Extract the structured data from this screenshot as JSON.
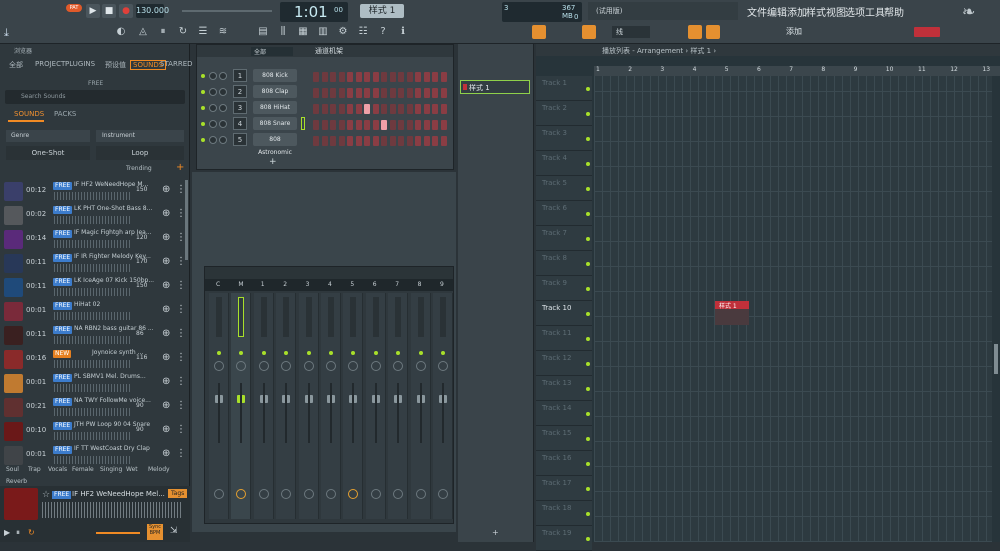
{
  "toolbar": {
    "mode": "PAT",
    "tempo": "130.000",
    "time": "1:01",
    "time_sub": "00",
    "pattern": "样式 1",
    "cpu": "3",
    "mem": "367 MB",
    "mem2": "0",
    "hint": "(试用版)",
    "snap": "线",
    "add_label": "添加"
  },
  "menu": [
    "文件",
    "编辑",
    "添加",
    "样式",
    "视图",
    "选项",
    "工具",
    "帮助"
  ],
  "browser": {
    "title": "浏览器",
    "tabs": [
      "全部",
      "PROJECT",
      "PLUGINS",
      "预设值",
      "SOUNDS",
      "STARRED"
    ],
    "free_toggle": "FREE",
    "search": "Search Sounds",
    "sub_tabs": [
      "SOUNDS",
      "PACKS"
    ],
    "filters": [
      "Genre",
      "Instrument"
    ],
    "type_tabs": [
      "One-Shot",
      "Loop"
    ],
    "sort": "Trending",
    "items": [
      {
        "dur": "00:12",
        "name": "IF HF2 WeNeedHope M...",
        "bpm": "150",
        "badge": "FREE",
        "color": "#3a3f6a"
      },
      {
        "dur": "00:02",
        "name": "LK PHT One-Shot Bass 8...",
        "bpm": "",
        "badge": "FREE",
        "color": "#55585c"
      },
      {
        "dur": "00:14",
        "name": "IF Magic Fightgh arp Iea...",
        "bpm": "120",
        "badge": "FREE",
        "color": "#5a2a7a"
      },
      {
        "dur": "00:11",
        "name": "IF IR Fighter Melody Key...",
        "bpm": "170",
        "badge": "FREE",
        "color": "#283858"
      },
      {
        "dur": "00:11",
        "name": "LK IceAge 07 Kick 150bp...",
        "bpm": "150",
        "badge": "FREE",
        "color": "#1f4a7a"
      },
      {
        "dur": "00:01",
        "name": "HiHat 02",
        "bpm": "",
        "badge": "FREE",
        "color": "#7a2a3a"
      },
      {
        "dur": "00:11",
        "name": "NA RBN2 bass guitar 86 ...",
        "bpm": "86",
        "badge": "FREE",
        "color": "#3a2020"
      },
      {
        "dur": "00:16",
        "name": "Joynoice synth ...",
        "bpm": "116",
        "badge": "NEW",
        "color": "#8a2a2a"
      },
      {
        "dur": "00:01",
        "name": "PL SBMV1 Mel. Drums...",
        "bpm": "",
        "badge": "FREE",
        "color": "#c07a30"
      },
      {
        "dur": "00:21",
        "name": "NA TWY FollowMe voice...",
        "bpm": "90",
        "badge": "FREE",
        "color": "#603030"
      },
      {
        "dur": "00:10",
        "name": "JTH PW Loop 90 04 Snare",
        "bpm": "90",
        "badge": "FREE",
        "color": "#6a1818"
      },
      {
        "dur": "00:01",
        "name": "IF TT WestCoast Dry Clap",
        "bpm": "",
        "badge": "FREE",
        "color": "#404448"
      }
    ],
    "tags": [
      "Soul",
      "Trap",
      "Vocals",
      "Female",
      "Singing",
      "Wet",
      "Melody",
      "Reverb"
    ],
    "player": {
      "name": "IF HF2 WeNeedHope Mel...",
      "badge": "FREE",
      "tags_btn": "Tags",
      "sync": "Sync BPM"
    }
  },
  "rack": {
    "filter": "全部",
    "title": "通道机架",
    "channels": [
      {
        "num": "1",
        "name": "808 Kick"
      },
      {
        "num": "2",
        "name": "808 Clap"
      },
      {
        "num": "3",
        "name": "808 HiHat"
      },
      {
        "num": "4",
        "name": "808 Snare"
      },
      {
        "num": "5",
        "name": "808 Astronomic"
      }
    ],
    "add": "+"
  },
  "mixer": {
    "strips": [
      "C",
      "M",
      "1",
      "2",
      "3",
      "4",
      "5",
      "6",
      "7",
      "8",
      "9"
    ]
  },
  "playlist": {
    "breadcrumb": "播放列表 - Arrangement › 样式 1 ›",
    "pattern_item": "样式 1",
    "add": "+",
    "bar_numbers": [
      "1",
      "2",
      "3",
      "4",
      "5",
      "6",
      "7",
      "8",
      "9",
      "10",
      "11",
      "12",
      "13"
    ],
    "tracks": [
      "Track 1",
      "Track 2",
      "Track 3",
      "Track 4",
      "Track 5",
      "Track 6",
      "Track 7",
      "Track 8",
      "Track 9",
      "Track 10",
      "Track 11",
      "Track 12",
      "Track 13",
      "Track 14",
      "Track 15",
      "Track 16",
      "Track 17",
      "Track 18",
      "Track 19"
    ],
    "clip": "样式 1",
    "active_track": "Track 10"
  },
  "colors": {
    "accent": "#f08a24",
    "free": "#3c7ccc",
    "clip": "#c0303a",
    "led": "#a8e02a"
  }
}
